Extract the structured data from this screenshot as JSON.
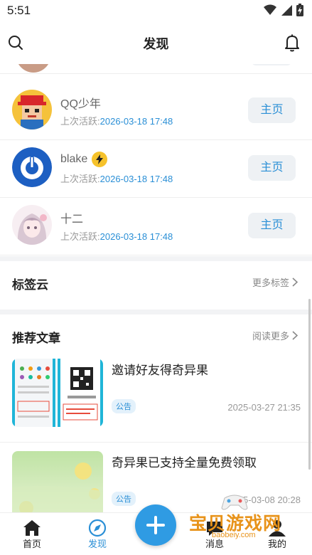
{
  "status_bar": {
    "time": "5:51",
    "icons": [
      "wifi-icon",
      "signal-icon",
      "battery-icon"
    ]
  },
  "header": {
    "title": "发现",
    "left_icon": "search-icon",
    "right_icon": "bell-icon"
  },
  "users": [
    {
      "name": "QQ少年",
      "meta_label": "上次活跃:",
      "last_active": "2026-03-18 17:48",
      "button": "主页",
      "avatar": "pixel-boy-avatar",
      "badge": null
    },
    {
      "name": "blake",
      "meta_label": "上次活跃:",
      "last_active": "2026-03-18 17:48",
      "button": "主页",
      "avatar": "blue-power-avatar",
      "badge": "lightning-icon"
    },
    {
      "name": "十二",
      "meta_label": "上次活跃:",
      "last_active": "2026-03-18 17:48",
      "button": "主页",
      "avatar": "anime-girl-avatar",
      "badge": null
    }
  ],
  "tag_cloud": {
    "title": "标签云",
    "more": "更多标签"
  },
  "articles_section": {
    "title": "推荐文章",
    "more": "阅读更多"
  },
  "articles": [
    {
      "title": "邀请好友得奇异果",
      "tag": "公告",
      "date": "2025-03-27 21:35"
    },
    {
      "title": "奇异果已支持全量免费领取",
      "tag": "公告",
      "date": "2025-03-08 20:28"
    }
  ],
  "tabbar": {
    "tabs": [
      {
        "label": "首页",
        "icon": "home-icon",
        "active": false
      },
      {
        "label": "发现",
        "icon": "compass-icon",
        "active": true
      },
      {
        "label": "消息",
        "icon": "message-icon",
        "active": false
      },
      {
        "label": "我的",
        "icon": "user-icon",
        "active": false
      }
    ],
    "fab_icon": "plus-icon"
  },
  "watermark": {
    "text": "宝贝游戏网",
    "sub": "baobeiy.com"
  },
  "colors": {
    "accent": "#2a8fd6",
    "fab": "#2f9be3",
    "separator": "#f2f3f5",
    "button_bg": "#eef1f4"
  }
}
